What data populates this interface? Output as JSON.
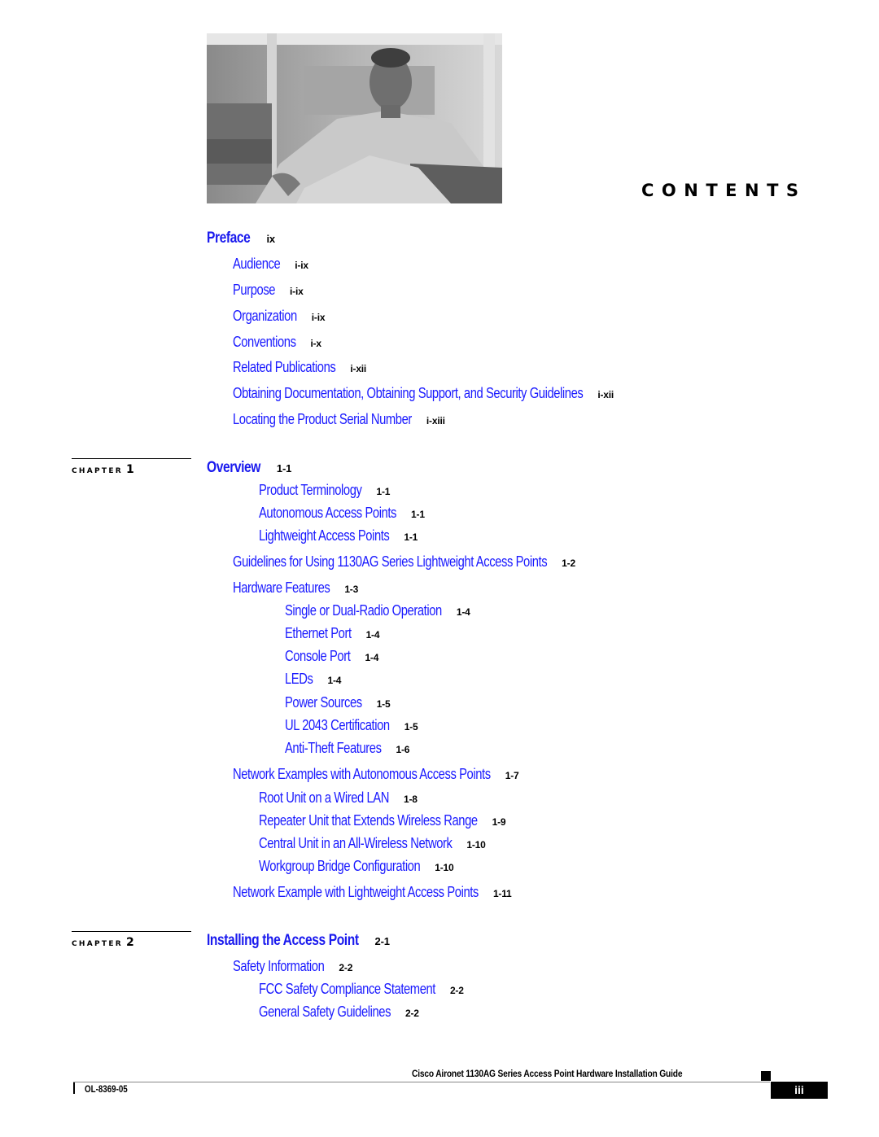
{
  "header": {
    "title": "CONTENTS",
    "photo": "grayscale-portrait-man-seated-on-couch"
  },
  "preface": {
    "title": "Preface",
    "page": "ix",
    "items": [
      {
        "title": "Audience",
        "page": "i-ix"
      },
      {
        "title": "Purpose",
        "page": "i-ix"
      },
      {
        "title": "Organization",
        "page": "i-ix"
      },
      {
        "title": "Conventions",
        "page": "i-x"
      },
      {
        "title": "Related Publications",
        "page": "i-xii"
      },
      {
        "title": "Obtaining Documentation, Obtaining Support, and Security Guidelines",
        "page": "i-xii"
      },
      {
        "title": "Locating the Product Serial Number",
        "page": "i-xiii"
      }
    ]
  },
  "chapters": [
    {
      "label": "CHAPTER",
      "number": "1",
      "title": "Overview",
      "page": "1-1",
      "items": [
        {
          "title": "Product Terminology",
          "page": "1-1",
          "level": 2
        },
        {
          "title": "Autonomous Access Points",
          "page": "1-1",
          "level": 2
        },
        {
          "title": "Lightweight Access Points",
          "page": "1-1",
          "level": 2
        },
        {
          "title": "Guidelines for Using 1130AG Series Lightweight Access Points",
          "page": "1-2",
          "level": 1
        },
        {
          "title": "Hardware Features",
          "page": "1-3",
          "level": 1
        },
        {
          "title": "Single or Dual-Radio Operation",
          "page": "1-4",
          "level": 3
        },
        {
          "title": "Ethernet Port",
          "page": "1-4",
          "level": 3
        },
        {
          "title": "Console Port",
          "page": "1-4",
          "level": 3
        },
        {
          "title": "LEDs",
          "page": "1-4",
          "level": 3
        },
        {
          "title": "Power Sources",
          "page": "1-5",
          "level": 3
        },
        {
          "title": "UL 2043 Certification",
          "page": "1-5",
          "level": 3
        },
        {
          "title": "Anti-Theft Features",
          "page": "1-6",
          "level": 3
        },
        {
          "title": "Network Examples with Autonomous Access Points",
          "page": "1-7",
          "level": 1
        },
        {
          "title": "Root Unit on a Wired LAN",
          "page": "1-8",
          "level": 2
        },
        {
          "title": "Repeater Unit that Extends Wireless Range",
          "page": "1-9",
          "level": 2
        },
        {
          "title": "Central Unit in an All-Wireless Network",
          "page": "1-10",
          "level": 2
        },
        {
          "title": "Workgroup Bridge Configuration",
          "page": "1-10",
          "level": 2
        },
        {
          "title": "Network Example with Lightweight Access Points",
          "page": "1-11",
          "level": 1
        }
      ]
    },
    {
      "label": "CHAPTER",
      "number": "2",
      "title": "Installing the Access Point",
      "page": "2-1",
      "items": [
        {
          "title": "Safety Information",
          "page": "2-2",
          "level": 1
        },
        {
          "title": "FCC Safety Compliance Statement",
          "page": "2-2",
          "level": 2
        },
        {
          "title": "General Safety Guidelines",
          "page": "2-2",
          "level": 2
        }
      ]
    }
  ],
  "footer": {
    "guide_title": "Cisco Aironet 1130AG Series Access Point Hardware Installation Guide",
    "doc_number": "OL-8369-05",
    "page_number": "iii"
  }
}
